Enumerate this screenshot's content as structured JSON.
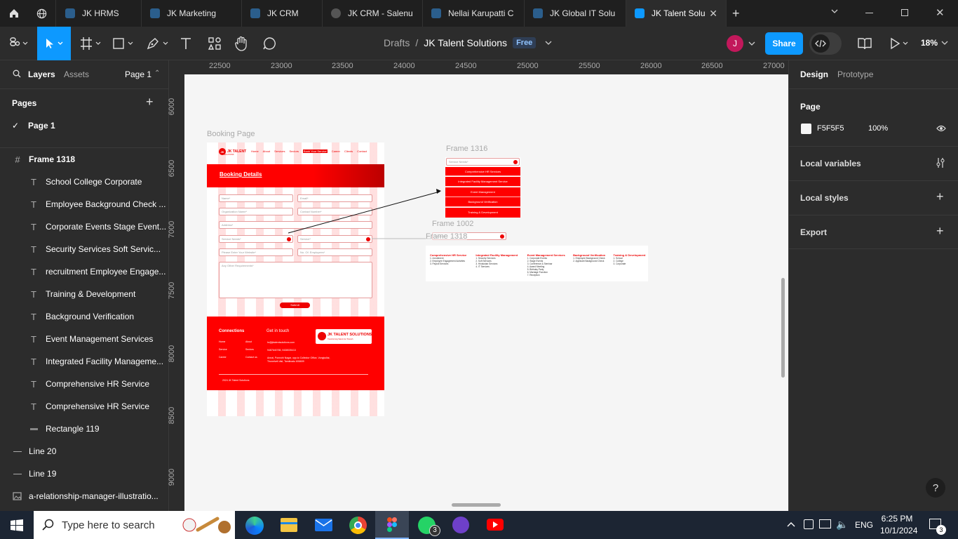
{
  "tabs": [
    {
      "label": "JK HRMS"
    },
    {
      "label": "JK Marketing"
    },
    {
      "label": "JK CRM"
    },
    {
      "label": "JK CRM - Salenu"
    },
    {
      "label": "Nellai Karupatti C"
    },
    {
      "label": "JK Global IT Solu"
    },
    {
      "label": "JK Talent Solu"
    }
  ],
  "toolbar": {
    "breadcrumb_root": "Drafts",
    "breadcrumb_sep": "/",
    "file_name": "JK Talent Solutions",
    "plan_badge": "Free",
    "avatar_initial": "J",
    "share_label": "Share",
    "zoom": "18%"
  },
  "left": {
    "tab_layers": "Layers",
    "tab_assets": "Assets",
    "page_selector": "Page 1",
    "pages_title": "Pages",
    "current_page": "Page 1",
    "layers": [
      {
        "name": "Frame 1318"
      },
      {
        "name": "School College Corporate"
      },
      {
        "name": "Employee Background Check ..."
      },
      {
        "name": "Corporate Events Stage Event..."
      },
      {
        "name": "Security Services Soft Servic..."
      },
      {
        "name": "recruitment Employee Engage..."
      },
      {
        "name": "Training & Development"
      },
      {
        "name": "Background Verification"
      },
      {
        "name": "Event Management Services"
      },
      {
        "name": "Integrated Facility Manageme..."
      },
      {
        "name": "Comprehensive HR Service"
      },
      {
        "name": "Comprehensive HR Service"
      },
      {
        "name": "Rectangle 119"
      },
      {
        "name": "Line 20"
      },
      {
        "name": "Line 19"
      },
      {
        "name": "a-relationship-manager-illustratio..."
      }
    ]
  },
  "ruler": {
    "top": [
      "22500",
      "23000",
      "23500",
      "24000",
      "24500",
      "25000",
      "25500",
      "26000",
      "26500",
      "27000"
    ],
    "left": [
      "6000",
      "6500",
      "7000",
      "7500",
      "8000",
      "8500",
      "9000"
    ]
  },
  "canvas": {
    "frames": {
      "booking": "Booking Page",
      "f1316": "Frame 1316",
      "f1002": "Frame 1002",
      "f1318": "Frame 1318"
    },
    "booking": {
      "brand": "JK TALENT",
      "brand_sub": "SOLUTIONS",
      "nav": [
        "Home",
        "About",
        "Services",
        "Sectors",
        "Book Your Service",
        "Career",
        "Clients",
        "Contact"
      ],
      "hero_title": "Booking Details",
      "fields": [
        "Name*",
        "Email*",
        "Organization Name*",
        "Contact Number*",
        "Address*",
        "Service Needs*",
        "Service*",
        "Please Enter Your Website*",
        "No. Of. Employees*"
      ],
      "textarea": "Any Other Requirements*",
      "submit": "Submit",
      "footer_connections": "Connections",
      "footer_getintouch": "Get in touch",
      "footer_links": [
        "Home",
        "About",
        "Service",
        "Sectors",
        "Career",
        "Contact us"
      ],
      "footer_email": "hr@jktalentsolutions.com",
      "footer_phone": "9487640765, 9438035413",
      "footer_address": "Annai, Ponnohi Nagar, opp.to Collector Office, Vongkollai, Tirunelveli dist, Tamilnadu 606609",
      "footer_logo": "JK TALENT SOLUTIONS",
      "footer_tagline": "Transforming Talent into Triumph",
      "copyright": "2024 JK Talent Solutions"
    },
    "dropdown": {
      "header": "Service Needs*",
      "items": [
        "Comprehensive HR Services",
        "Integrated Facility Management Service",
        "Event Management",
        "Background Verification",
        "Training & Development"
      ]
    },
    "f1002_field": "Service*",
    "services_cols": [
      {
        "title": "Comprehensive HR Service",
        "items": [
          "1. recruitment",
          "2. Employee Engagement Activities",
          "3. Payroll Services"
        ]
      },
      {
        "title": "Integrated Facility Management",
        "items": [
          "1. Security Services",
          "2. Soft Services",
          "3. Hindustan Services",
          "4. IT Services"
        ]
      },
      {
        "title": "Event Management Services",
        "items": [
          "1. Corporate Events",
          "2. Stage Events",
          "3. Conference & Seminar",
          "4. Award Meeting",
          "5. Birthday Party",
          "6. Marriage Function",
          "7. Reception"
        ]
      },
      {
        "title": "Background Verification",
        "items": [
          "1. Employee Background Check",
          "2. Applicant Background Check"
        ]
      },
      {
        "title": "Training & Development",
        "items": [
          "1. School",
          "2. College",
          "3. Corporate"
        ]
      }
    ]
  },
  "right": {
    "tab_design": "Design",
    "tab_prototype": "Prototype",
    "page_title": "Page",
    "page_color": "F5F5F5",
    "page_opacity": "100%",
    "local_variables": "Local variables",
    "local_styles": "Local styles",
    "export": "Export",
    "help": "?"
  },
  "taskbar": {
    "search_placeholder": "Type here to search",
    "lang": "ENG",
    "time": "6:25 PM",
    "date": "10/1/2024",
    "whatsapp_badge": "3",
    "notif_badge": "3"
  },
  "colors": {
    "accent": "#0d99ff",
    "brand_red": "#ff0000",
    "avatar": "#c2185b",
    "page_bg": "#f5f5f5"
  }
}
